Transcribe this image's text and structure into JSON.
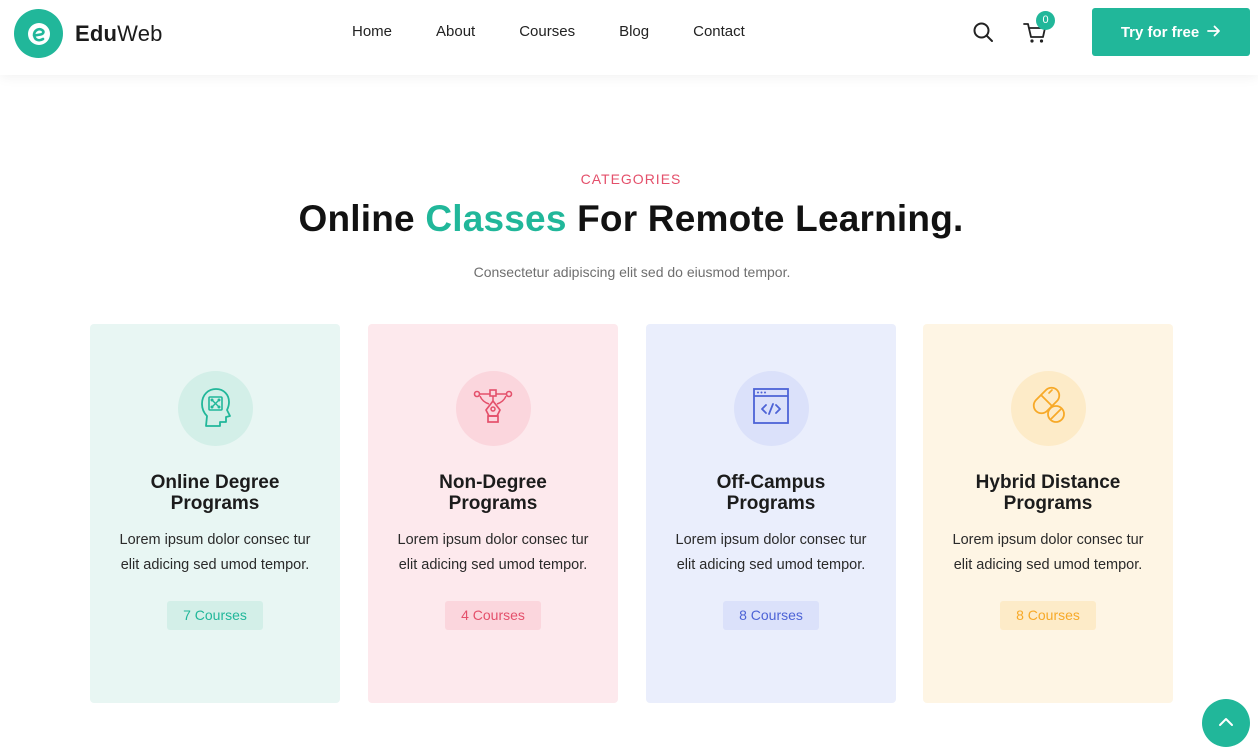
{
  "brand": {
    "name_bold": "Edu",
    "name_light": "Web",
    "color": "#21b79a"
  },
  "nav": {
    "items": [
      {
        "label": "Home"
      },
      {
        "label": "About"
      },
      {
        "label": "Courses"
      },
      {
        "label": "Blog"
      },
      {
        "label": "Contact"
      }
    ]
  },
  "header": {
    "search_icon": "search-icon",
    "cart_icon": "cart-icon",
    "cart_count": "0",
    "cta_label": "Try for free",
    "cta_icon": "arrow-right-icon"
  },
  "section": {
    "eyebrow": "CATEGORIES",
    "title_part1": "Online ",
    "title_accent": "Classes",
    "title_part2": " For Remote Learning.",
    "subtitle": "Consectetur adipiscing elit sed do eiusmod tempor."
  },
  "cards": [
    {
      "title": "Online Degree Programs",
      "description": "Lorem ipsum dolor consec tur elit adicing sed umod tempor.",
      "count": "7 Courses",
      "icon": "brain-head-icon",
      "bg": "#e8f6f3",
      "circle": "#d3efe8",
      "accent": "#21b79a",
      "badge_bg": "#d3efe8"
    },
    {
      "title": "Non-Degree Programs",
      "description": "Lorem ipsum dolor consec tur elit adicing sed umod tempor.",
      "count": "4 Courses",
      "icon": "pen-tool-icon",
      "bg": "#fde9ed",
      "circle": "#fbd6dd",
      "accent": "#e4506b",
      "badge_bg": "#fbd6dd"
    },
    {
      "title": "Off-Campus Programs",
      "description": "Lorem ipsum dolor consec tur elit adicing sed umod tempor.",
      "count": "8 Courses",
      "icon": "code-window-icon",
      "bg": "#eaeefc",
      "circle": "#dbe1fa",
      "accent": "#4d63d6",
      "badge_bg": "#dbe1fa"
    },
    {
      "title": "Hybrid Distance Programs",
      "description": "Lorem ipsum dolor consec tur elit adicing sed umod tempor.",
      "count": "8 Courses",
      "icon": "pills-icon",
      "bg": "#fef5e4",
      "circle": "#fdebc8",
      "accent": "#f7a928",
      "badge_bg": "#fdebc8"
    }
  ],
  "scroll_top": {
    "icon": "chevron-up-icon"
  }
}
